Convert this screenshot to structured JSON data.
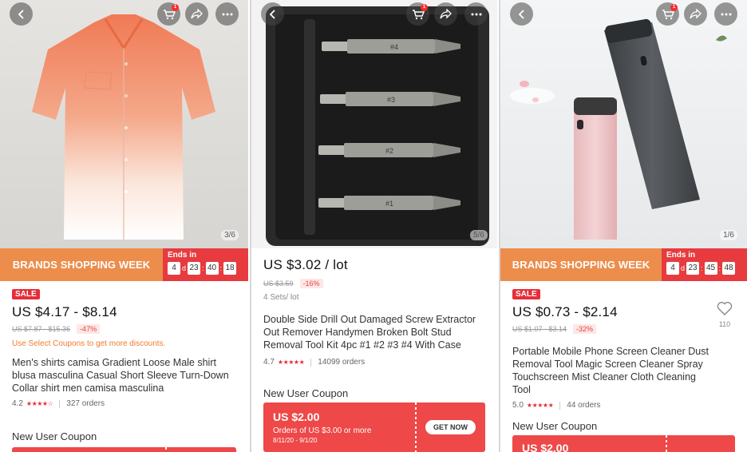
{
  "panels": [
    {
      "page_indicator": "3/6",
      "cart_badge": "1",
      "brand_banner": "BRANDS SHOPPING WEEK",
      "ends_label": "Ends in",
      "countdown": {
        "days": "4",
        "d_label": "d",
        "hours": "23",
        "minutes": "40",
        "seconds": "18"
      },
      "sale_badge": "SALE",
      "price": "US $4.17 - $8.14",
      "old_price": "US $7.87 - $15.36",
      "discount": "-47%",
      "notice": "Use Select Coupons to get more discounts.",
      "title": "Men's shirts camisa Gradient Loose Male shirt blusa masculina Casual Short Sleeve Turn-Down Collar shirt men camisa masculina",
      "rating": "4.2",
      "stars": "★★★★☆",
      "orders": "327 orders",
      "new_user_coupon": "New User Coupon"
    },
    {
      "page_indicator": "5/6",
      "cart_badge": "1",
      "price": "US $3.02 / lot",
      "old_price": "US $3.59",
      "discount": "-16%",
      "sets": "4 Sets/ lot",
      "title": "Double Side Drill Out Damaged Screw Extractor Out Remover Handymen Broken Bolt Stud Removal Tool Kit 4pc #1 #2 #3 #4 With Case",
      "rating": "4.7",
      "stars": "★★★★★",
      "orders": "14099 orders",
      "new_user_coupon": "New User Coupon",
      "coupon": {
        "amount": "US $2.00",
        "condition": "Orders of US $3.00 or more",
        "dates": "8/11/20 - 9/1/20",
        "button": "GET NOW"
      },
      "bit_labels": [
        "#4",
        "#3",
        "#2",
        "#1"
      ]
    },
    {
      "page_indicator": "1/6",
      "cart_badge": "1",
      "brand_banner": "BRANDS SHOPPING WEEK",
      "ends_label": "Ends in",
      "countdown": {
        "days": "4",
        "d_label": "d",
        "hours": "23",
        "minutes": "45",
        "seconds": "48"
      },
      "sale_badge": "SALE",
      "price": "US $0.73 - $2.14",
      "old_price": "US $1.07 - $3.14",
      "discount": "-32%",
      "title": "Portable Mobile Phone Screen Cleaner Dust Removal Tool Magic Screen Cleaner Spray Touchscreen Mist Cleaner Cloth Cleaning Tool",
      "rating": "5.0",
      "stars": "★★★★★",
      "orders": "44 orders",
      "wishlist_count": "110",
      "new_user_coupon": "New User Coupon",
      "coupon": {
        "amount": "US $2.00"
      }
    }
  ],
  "icons": [
    "back-arrow-icon",
    "cart-icon",
    "share-icon",
    "more-icon",
    "heart-icon"
  ],
  "colors": {
    "brand_orange": "#ec8d4c",
    "countdown_red": "#e73b3f",
    "sale_red": "#e62e3a",
    "coupon_red": "#ee4848",
    "notice_orange": "#f07b2e"
  }
}
